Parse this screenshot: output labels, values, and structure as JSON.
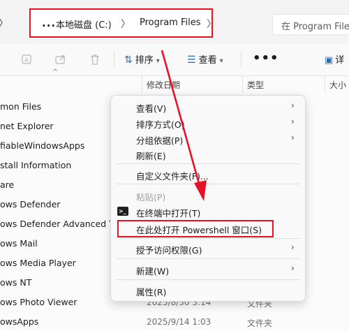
{
  "address": {
    "back_glyph": "〉",
    "more": "...",
    "crumbs": [
      "本地磁盘 (C:)",
      "Program Files"
    ],
    "sep": "〉",
    "search_placeholder": "在 Program Files"
  },
  "toolbar": {
    "sort_label": "排序",
    "view_label": "查看",
    "more_label": "•••",
    "details_label": "详"
  },
  "headers": {
    "date": "修改日期",
    "type": "类型",
    "size": "大小"
  },
  "files": [
    {
      "name": "mon Files",
      "date": "",
      "type": ""
    },
    {
      "name": "net Explorer",
      "date": "",
      "type": ""
    },
    {
      "name": "fiableWindowsApps",
      "date": "",
      "type": ""
    },
    {
      "name": "stall Information",
      "date": "",
      "type": ""
    },
    {
      "name": "are",
      "date": "",
      "type": ""
    },
    {
      "name": "ows Defender",
      "date": "",
      "type": ""
    },
    {
      "name": "ows Defender Advanced Th",
      "date": "",
      "type": ""
    },
    {
      "name": "ows Mail",
      "date": "",
      "type": ""
    },
    {
      "name": "ows Media Player",
      "date": "",
      "type": ""
    },
    {
      "name": "ows NT",
      "date": "",
      "type": ""
    },
    {
      "name": "ows Photo Viewer",
      "date": "2025/8/30 3:14",
      "type": "文件夹"
    },
    {
      "name": "owsApps",
      "date": "2025/9/14 1:03",
      "type": "文件夹"
    }
  ],
  "context_menu": {
    "items": [
      {
        "label": "查看(V)",
        "has_submenu": true,
        "disabled": false
      },
      {
        "label": "排序方式(O)",
        "has_submenu": true,
        "disabled": false
      },
      {
        "label": "分组依据(P)",
        "has_submenu": true,
        "disabled": false
      },
      {
        "label": "刷新(E)",
        "has_submenu": false,
        "disabled": false
      },
      {
        "label": "自定义文件夹(F)...",
        "has_submenu": false,
        "disabled": false
      },
      {
        "label": "粘贴(P)",
        "has_submenu": false,
        "disabled": true
      },
      {
        "label": "在终端中打开(T)",
        "has_submenu": false,
        "disabled": false
      },
      {
        "label": "在此处打开 Powershell 窗口(S)",
        "has_submenu": false,
        "disabled": false
      },
      {
        "label": "授予访问权限(G)",
        "has_submenu": true,
        "disabled": false
      },
      {
        "label": "新建(W)",
        "has_submenu": true,
        "disabled": false
      },
      {
        "label": "属性(R)",
        "has_submenu": false,
        "disabled": false
      }
    ],
    "submenu_glyph": "›",
    "terminal_icon_text": ">_"
  },
  "colors": {
    "highlight_red": "#e81123",
    "accent_blue": "#2b6cb0"
  }
}
